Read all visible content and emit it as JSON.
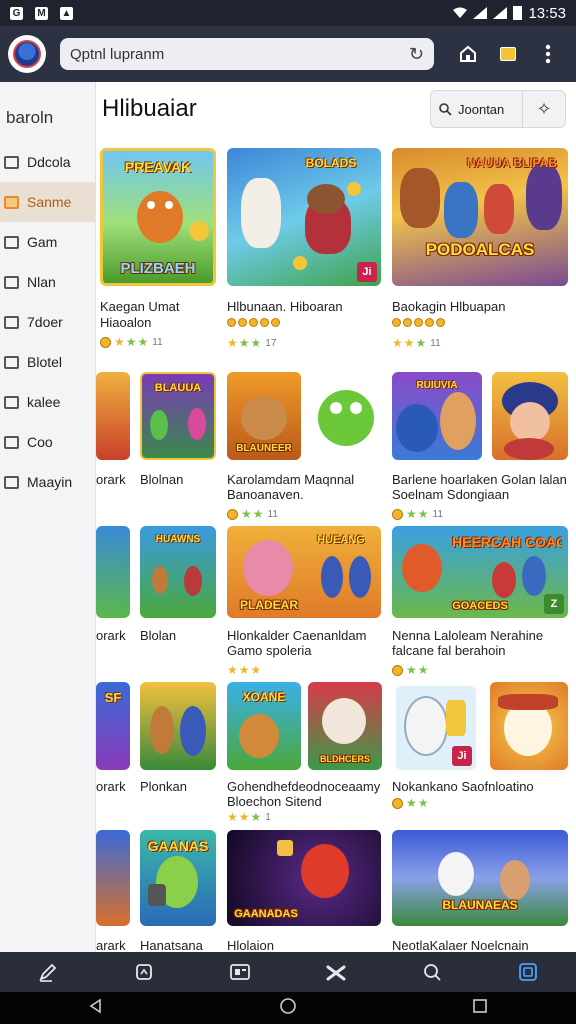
{
  "status_bar": {
    "time": "13:53",
    "left_icons": [
      "gmail-icon",
      "m-icon",
      "image-icon"
    ]
  },
  "browser": {
    "url_text": "Qptnl lupranm"
  },
  "sidebar": {
    "header": "baroln",
    "items": [
      {
        "label": "Ddcola",
        "icon": "mail-icon",
        "active": false
      },
      {
        "label": "Sanme",
        "icon": "folder-icon",
        "active": true
      },
      {
        "label": "Gam",
        "icon": "calendar-icon",
        "active": false
      },
      {
        "label": "Nlan",
        "icon": "box-icon",
        "active": false
      },
      {
        "label": "7doer",
        "icon": "calendar-icon",
        "active": false
      },
      {
        "label": "Blotel",
        "icon": "tray-icon",
        "active": false
      },
      {
        "label": "kalee",
        "icon": "calendar-icon",
        "active": false
      },
      {
        "label": "Coo",
        "icon": "tray-icon",
        "active": false
      },
      {
        "label": "Maayin",
        "icon": "box-icon",
        "active": false
      }
    ]
  },
  "main": {
    "title": "Hlibuaiar",
    "search_label": "Joontan"
  },
  "rows": [
    {
      "cards": [
        {
          "title": "Kaegan Umat",
          "title2": "Hiaoalon",
          "caption_top": "PREAVAK",
          "caption_bottom": "PLIZBAEH",
          "rating": "11",
          "stars": 3
        },
        {
          "title": "Hlbunaan. Hiboaran",
          "title2": "",
          "caption_top": "BOLADS",
          "caption_bottom": "",
          "rating": "17",
          "stars": 3
        },
        {
          "title": "Baokagin Hlbuapan",
          "title2": "",
          "caption_top": "NAUUA BLIPAB",
          "caption_bottom": "PODOALCAS",
          "rating": "11",
          "stars": 3
        }
      ]
    },
    {
      "cards": [
        {
          "title": "orark",
          "title2": "",
          "caption_top": "",
          "caption_bottom": "",
          "rating": "",
          "stars": 0
        },
        {
          "title": "Blolnan",
          "title2": "",
          "caption_top": "BLAUUA",
          "caption_bottom": "",
          "rating": "",
          "stars": 0
        },
        {
          "title": "Karolamdam Maqnnal",
          "title2": "Banoanaven.",
          "caption_top": "",
          "caption_bottom": "BLAUNEER",
          "rating": "11",
          "stars": 2
        },
        {
          "title": "Barlene hoarlaken Golan lalan",
          "title2": "Soelnam Sdongiaan",
          "caption_top": "RUIUVIA",
          "caption_bottom": "",
          "rating": "11",
          "stars": 2
        }
      ]
    },
    {
      "cards": [
        {
          "title": "orark",
          "title2": "",
          "caption_top": "",
          "caption_bottom": "",
          "rating": "",
          "stars": 0
        },
        {
          "title": "Blolan",
          "title2": "",
          "caption_top": "HUAWNS",
          "caption_bottom": "",
          "rating": "",
          "stars": 0
        },
        {
          "title": "Hlonkalder Caenanldam",
          "title2": "Gamo spoleria",
          "caption_top": "HUEANG",
          "caption_bottom": "PLADEAR",
          "rating": "",
          "stars": 3
        },
        {
          "title": "Nenna Laloleam Nerahine",
          "title2": "falcane fal berahoin",
          "caption_top": "HEERCAH COAGES",
          "caption_bottom": "GOACEDS",
          "rating": "",
          "stars": 2
        }
      ]
    },
    {
      "cards": [
        {
          "title": "orark",
          "title2": "",
          "caption_top": "SF",
          "caption_bottom": "",
          "rating": "",
          "stars": 0
        },
        {
          "title": "Plonkan",
          "title2": "",
          "caption_top": "",
          "caption_bottom": "",
          "rating": "",
          "stars": 0
        },
        {
          "title": "Gohendhefdeodnoceaamy",
          "title2": "Bloechon Sitend",
          "caption_top": "XOANE",
          "caption_bottom": "BLDHCERS",
          "rating": "1",
          "stars": 3
        },
        {
          "title": "Nokankano Saofnloatino",
          "title2": "",
          "caption_top": "",
          "caption_bottom": "",
          "rating": "",
          "stars": 2
        }
      ]
    },
    {
      "cards": [
        {
          "title": "arark",
          "title2": "",
          "caption_top": "",
          "caption_bottom": "",
          "rating": "",
          "stars": 0
        },
        {
          "title": "Hanatsana",
          "title2": "",
          "caption_top": "GAANAS",
          "caption_bottom": "",
          "rating": "",
          "stars": 0
        },
        {
          "title": "Hlolaion",
          "title2": "",
          "caption_top": "",
          "caption_bottom": "GAANADAS",
          "rating": "",
          "stars": 0
        },
        {
          "title": "NeotlaKalaer Noelcnain",
          "title2": "",
          "caption_top": "",
          "caption_bottom": "BLAUNAEAS",
          "rating": "",
          "stars": 0
        }
      ]
    }
  ],
  "bottom_nav": [
    "pencil-icon",
    "home-icon",
    "card-icon",
    "tools-icon",
    "search-icon",
    "tabs-icon"
  ],
  "system_nav": [
    "back-icon",
    "home-circle-icon",
    "recents-icon"
  ]
}
